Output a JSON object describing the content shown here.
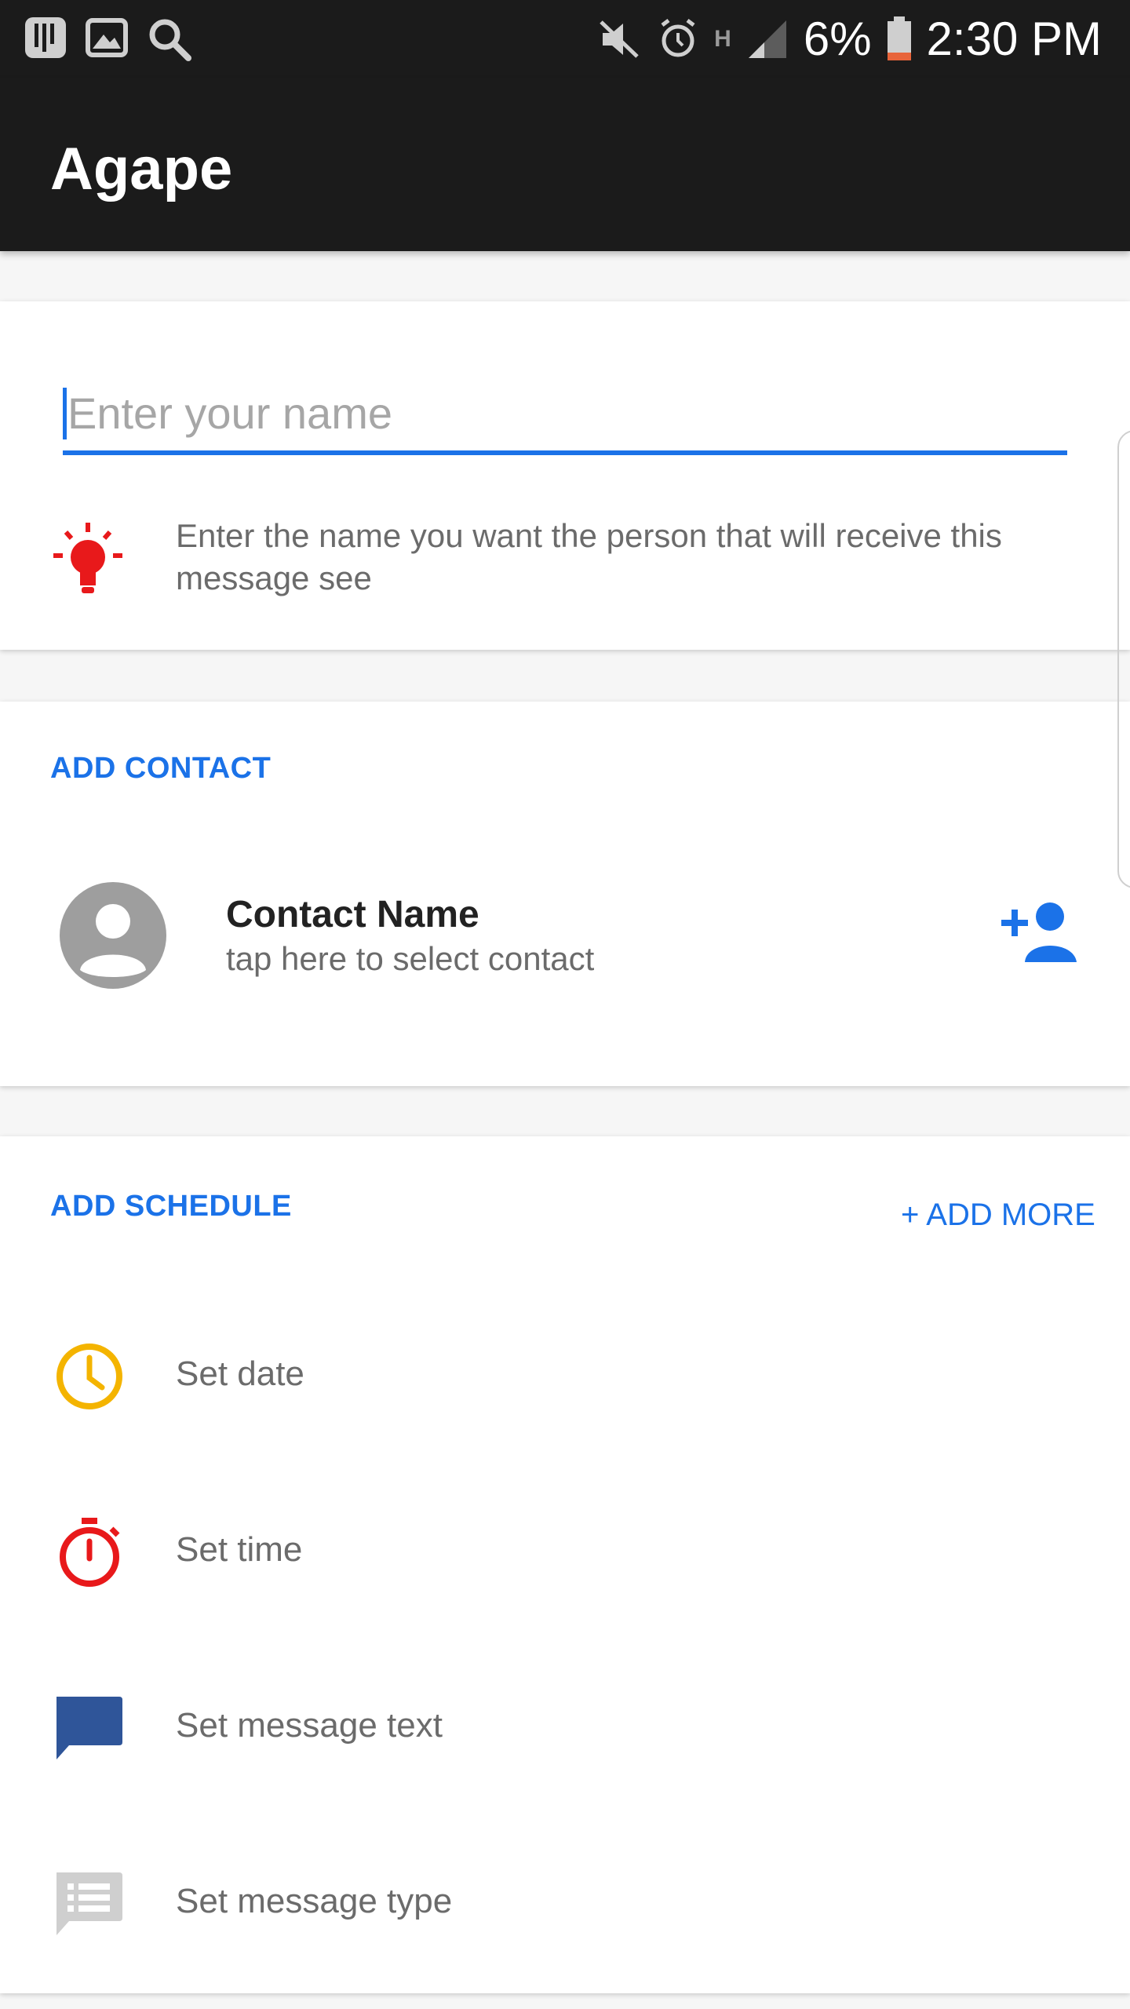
{
  "status_bar": {
    "battery_percent": "6%",
    "time": "2:30 PM",
    "network_label": "H"
  },
  "app_bar": {
    "title": "Agape"
  },
  "name_card": {
    "input_placeholder": "Enter your name",
    "input_value": "",
    "hint_text": "Enter the name you want the person that will receive this message see",
    "hint_icon": "lightbulb-icon"
  },
  "contact_card": {
    "section_label": "ADD CONTACT",
    "contact_name": "Contact Name",
    "contact_subtitle": "tap here to select contact",
    "avatar_icon": "avatar-icon",
    "add_icon": "add-person-icon"
  },
  "schedule_card": {
    "section_label": "ADD SCHEDULE",
    "add_more_label": "+ ADD MORE",
    "items": [
      {
        "label": "Set date",
        "icon": "clock-icon"
      },
      {
        "label": "Set time",
        "icon": "stopwatch-icon"
      },
      {
        "label": "Set message text",
        "icon": "message-icon"
      },
      {
        "label": "Set message type",
        "icon": "message-list-icon"
      }
    ]
  },
  "colors": {
    "accent": "#1b72e8",
    "status_bar": "#1b1b1b",
    "hint_red": "#e8191b",
    "clock_yellow": "#f4b400",
    "stopwatch_red": "#e8191b",
    "message_blue": "#2f5599",
    "message_type_gray": "#cfcfcf",
    "avatar_gray": "#9e9e9e"
  }
}
